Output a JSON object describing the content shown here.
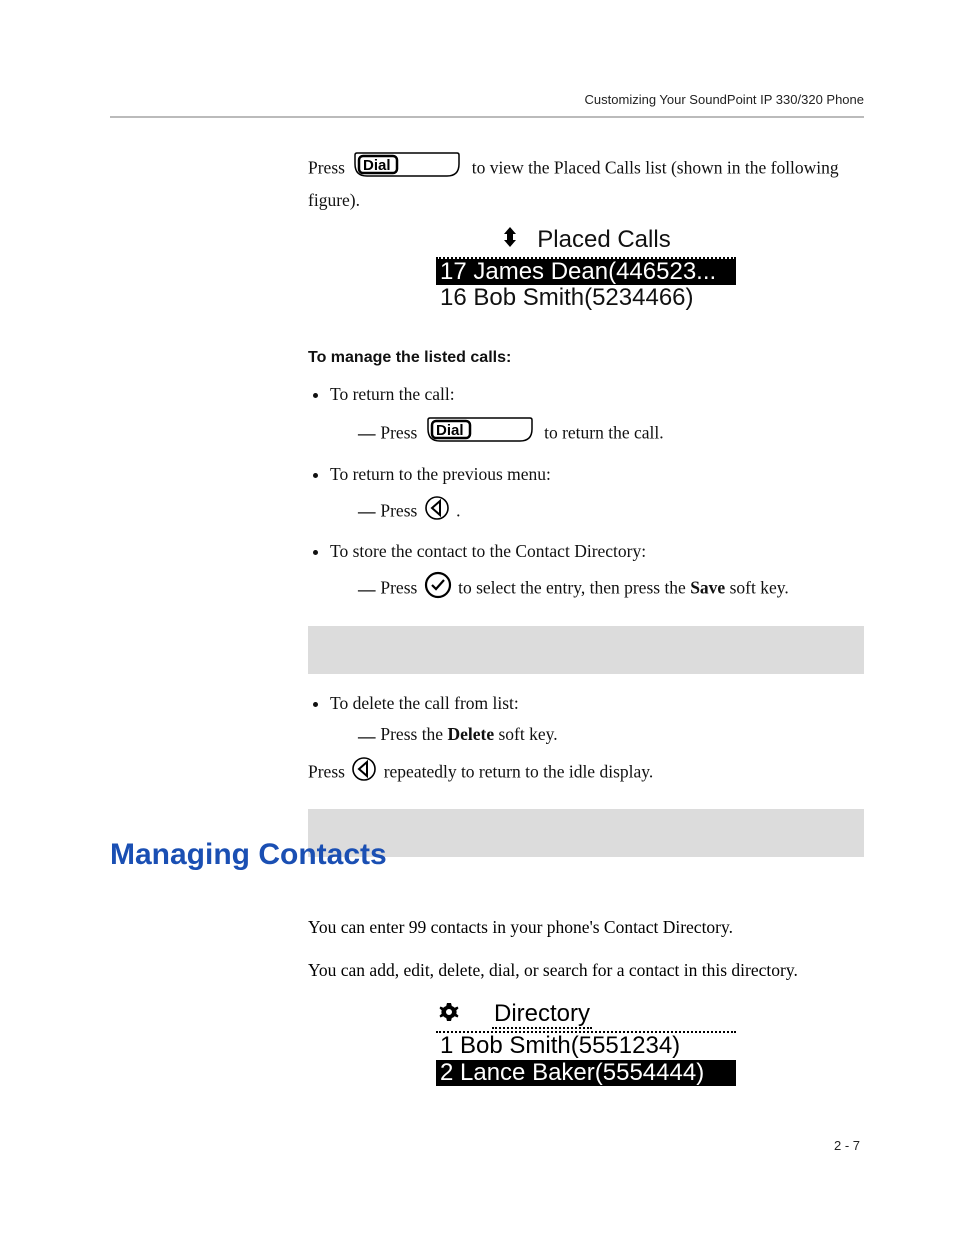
{
  "header": {
    "running_head": "Customizing Your SoundPoint IP 330/320 Phone"
  },
  "para_press_dial": {
    "before": "Press ",
    "after": " to view the Placed Calls list (shown in the following figure).",
    "dial_label": "Dial"
  },
  "fig_placed": {
    "title": "Placed Calls",
    "row_selected": "17 James Dean(446523...",
    "row2": "16 Bob Smith(5234466)"
  },
  "manage_heading": "To manage the listed calls:",
  "bullets": {
    "return_call": "To return the call:",
    "return_call_press_before": "Press ",
    "return_call_press_after": " to return the call.",
    "dial_label2": "Dial",
    "prev_menu": "To return to the previous menu:",
    "prev_menu_press": "Press ",
    "prev_menu_period": ".",
    "store_contact": "To store the contact to the Contact Directory:",
    "store_press_before": "Press ",
    "store_press_mid": " to select the entry, then press the ",
    "store_save_word": "Save",
    "store_press_after": " soft key.",
    "delete_call": "To delete the call from list:",
    "delete_press_before": "Press the ",
    "delete_word": "Delete",
    "delete_press_after": " soft key."
  },
  "return_idle": {
    "before": "Press ",
    "after": " repeatedly to return to the idle display."
  },
  "h1": "Managing Contacts",
  "section2": {
    "p1": "You can enter 99 contacts in your phone's Contact Directory.",
    "p2": "You can add, edit, delete, dial, or search for a contact in this directory."
  },
  "fig_dir": {
    "title": "Directory",
    "row1": "1 Bob Smith(5551234)",
    "row_selected": "2 Lance Baker(5554444)"
  },
  "footer": {
    "page": "2 - 7"
  }
}
